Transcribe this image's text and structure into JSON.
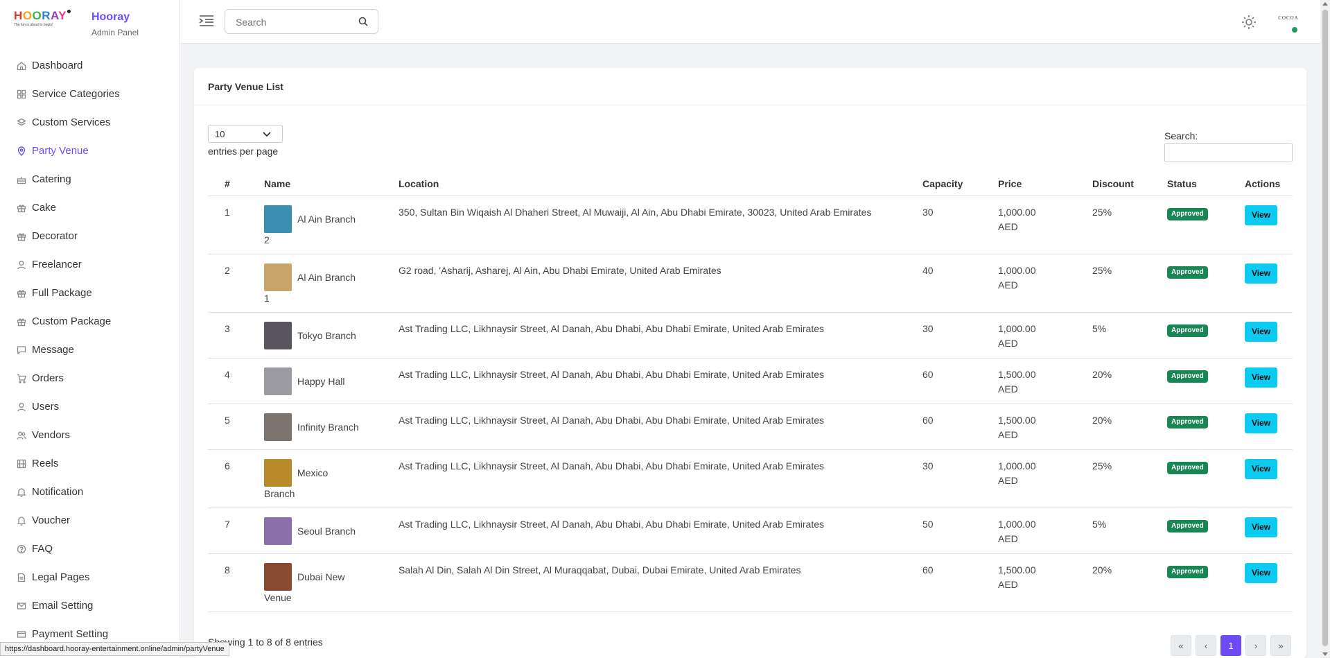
{
  "brand": {
    "logo_text": "HOORAY",
    "logo_tagline": "The fun is about to begin!",
    "name": "Hooray",
    "subtitle": "Admin Panel"
  },
  "sidebar": {
    "items": [
      {
        "label": "Dashboard",
        "icon": "home-icon"
      },
      {
        "label": "Service Categories",
        "icon": "grid-icon"
      },
      {
        "label": "Custom Services",
        "icon": "layers-icon"
      },
      {
        "label": "Party Venue",
        "icon": "map-pin-icon",
        "active": true
      },
      {
        "label": "Catering",
        "icon": "cake-icon"
      },
      {
        "label": "Cake",
        "icon": "gift-icon"
      },
      {
        "label": "Decorator",
        "icon": "gift-icon"
      },
      {
        "label": "Freelancer",
        "icon": "user-icon"
      },
      {
        "label": "Full Package",
        "icon": "gift-icon"
      },
      {
        "label": "Custom Package",
        "icon": "gift-icon"
      },
      {
        "label": "Message",
        "icon": "message-icon"
      },
      {
        "label": "Orders",
        "icon": "cart-icon"
      },
      {
        "label": "Users",
        "icon": "user-icon"
      },
      {
        "label": "Vendors",
        "icon": "users-icon"
      },
      {
        "label": "Reels",
        "icon": "film-icon"
      },
      {
        "label": "Notification",
        "icon": "bell-icon"
      },
      {
        "label": "Voucher",
        "icon": "bell-icon"
      },
      {
        "label": "FAQ",
        "icon": "help-icon"
      },
      {
        "label": "Legal Pages",
        "icon": "file-icon"
      },
      {
        "label": "Email Setting",
        "icon": "mail-icon"
      },
      {
        "label": "Payment Setting",
        "icon": "card-icon"
      }
    ]
  },
  "header": {
    "search_placeholder": "Search",
    "avatar_text": "COCOA"
  },
  "card": {
    "title": "Party Venue List",
    "per_page_value": "10",
    "per_page_label": "entries per page",
    "search_label": "Search:",
    "columns": [
      "#",
      "Name",
      "Location",
      "Capacity",
      "Price",
      "Discount",
      "Status",
      "Actions"
    ],
    "rows": [
      {
        "num": "1",
        "name1": "Al Ain Branch",
        "name2": "2",
        "location": "350, Sultan Bin Wiqaish Al Dhaheri Street, Al Muwaiji, Al Ain, Abu Dhabi Emirate, 30023, United Arab Emirates",
        "capacity": "30",
        "price1": "1,000.00",
        "price2": "AED",
        "discount": "25%",
        "status": "Approved",
        "action": "View",
        "thumb": "#3c8fb0"
      },
      {
        "num": "2",
        "name1": "Al Ain Branch",
        "name2": "1",
        "location": "G2 road, 'Asharij, Asharej, Al Ain, Abu Dhabi Emirate, United Arab Emirates",
        "capacity": "40",
        "price1": "1,000.00",
        "price2": "AED",
        "discount": "25%",
        "status": "Approved",
        "action": "View",
        "thumb": "#c9a46a"
      },
      {
        "num": "3",
        "name1": "Tokyo Branch",
        "name2": "",
        "location": "Ast Trading LLC, Likhnaysir Street, Al Danah, Abu Dhabi, Abu Dhabi Emirate, United Arab Emirates",
        "capacity": "30",
        "price1": "1,000.00",
        "price2": "AED",
        "discount": "5%",
        "status": "Approved",
        "action": "View",
        "thumb": "#5a5560"
      },
      {
        "num": "4",
        "name1": "Happy Hall",
        "name2": "",
        "location": "Ast Trading LLC, Likhnaysir Street, Al Danah, Abu Dhabi, Abu Dhabi Emirate, United Arab Emirates",
        "capacity": "60",
        "price1": "1,500.00",
        "price2": "AED",
        "discount": "20%",
        "status": "Approved",
        "action": "View",
        "thumb": "#9a9aa0"
      },
      {
        "num": "5",
        "name1": "Infinity Branch",
        "name2": "",
        "location": "Ast Trading LLC, Likhnaysir Street, Al Danah, Abu Dhabi, Abu Dhabi Emirate, United Arab Emirates",
        "capacity": "60",
        "price1": "1,500.00",
        "price2": "AED",
        "discount": "20%",
        "status": "Approved",
        "action": "View",
        "thumb": "#7d7470"
      },
      {
        "num": "6",
        "name1": "Mexico",
        "name2": "Branch",
        "location": "Ast Trading LLC, Likhnaysir Street, Al Danah, Abu Dhabi, Abu Dhabi Emirate, United Arab Emirates",
        "capacity": "30",
        "price1": "1,000.00",
        "price2": "AED",
        "discount": "25%",
        "status": "Approved",
        "action": "View",
        "thumb": "#b88a2a"
      },
      {
        "num": "7",
        "name1": "Seoul Branch",
        "name2": "",
        "location": "Ast Trading LLC, Likhnaysir Street, Al Danah, Abu Dhabi, Abu Dhabi Emirate, United Arab Emirates",
        "capacity": "50",
        "price1": "1,000.00",
        "price2": "AED",
        "discount": "5%",
        "status": "Approved",
        "action": "View",
        "thumb": "#8a6fa8"
      },
      {
        "num": "8",
        "name1": "Dubai New",
        "name2": "Venue",
        "location": "Salah Al Din, Salah Al Din Street, Al Muraqqabat, Dubai, Dubai Emirate, United Arab Emirates",
        "capacity": "60",
        "price1": "1,500.00",
        "price2": "AED",
        "discount": "20%",
        "status": "Approved",
        "action": "View",
        "thumb": "#8a4a32"
      }
    ],
    "footer_info": "Showing 1 to 8 of 8 entries",
    "pagination": [
      "«",
      "‹",
      "1",
      "›",
      "»"
    ],
    "active_page": "1"
  },
  "status_bar": {
    "url": "https://dashboard.hooray-entertainment.online/admin/partyVenue"
  },
  "colors": {
    "accent": "#6c4bf5",
    "approved": "#198754",
    "view_button": "#0dcaf0"
  }
}
